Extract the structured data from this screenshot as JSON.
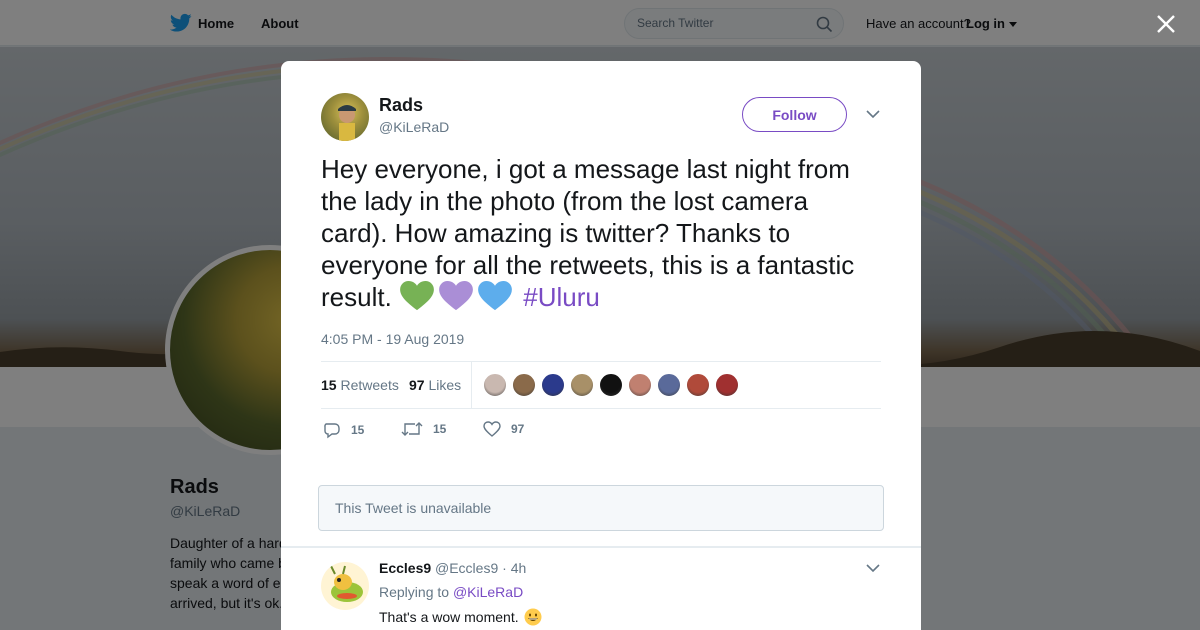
{
  "nav": {
    "home_label": "Home",
    "about_label": "About",
    "search_placeholder": "Search Twitter",
    "have_account": "Have an account?",
    "login_label": "Log in"
  },
  "profile": {
    "name": "Rads",
    "handle": "@KiLeRaD",
    "bio_visible": "Daughter of a hard\nfamily who came b\nspeak a word of e\narrived, but it's ok."
  },
  "tweet": {
    "author_name": "Rads",
    "author_handle": "@KiLeRaD",
    "follow_label": "Follow",
    "text": "Hey everyone, i got a message last night from the lady in the photo (from the lost camera card). How amazing is twitter? Thanks to everyone for all the retweets, this is a fantastic result.",
    "emojis": [
      "green-heart",
      "purple-heart",
      "blue-heart"
    ],
    "hashtag": "#Uluru",
    "timestamp": "4:05 PM - 19 Aug 2019",
    "retweets_count": "15",
    "retweets_label": "Retweets",
    "likes_count": "97",
    "likes_label": "Likes",
    "actions": {
      "reply_count": "15",
      "retweet_count": "15",
      "like_count": "97"
    },
    "liker_avatar_colors": [
      "#c9b8b0",
      "#8a6a4a",
      "#2b3a8c",
      "#a89068",
      "#111111",
      "#c08070",
      "#5a6a9a",
      "#b04a3a",
      "#a03030"
    ]
  },
  "unavailable_text": "This Tweet is unavailable",
  "reply": {
    "author_name": "Eccles9",
    "author_handle": "@Eccles9",
    "age": "4h",
    "replying_to_prefix": "Replying to",
    "replying_to_handle": "@KiLeRaD",
    "text": "That's a wow moment.",
    "emoji": "grinning-face"
  },
  "colors": {
    "accent": "#794bc4",
    "twitter_blue": "#1da1f2",
    "muted": "#657786",
    "text": "#14171a"
  }
}
